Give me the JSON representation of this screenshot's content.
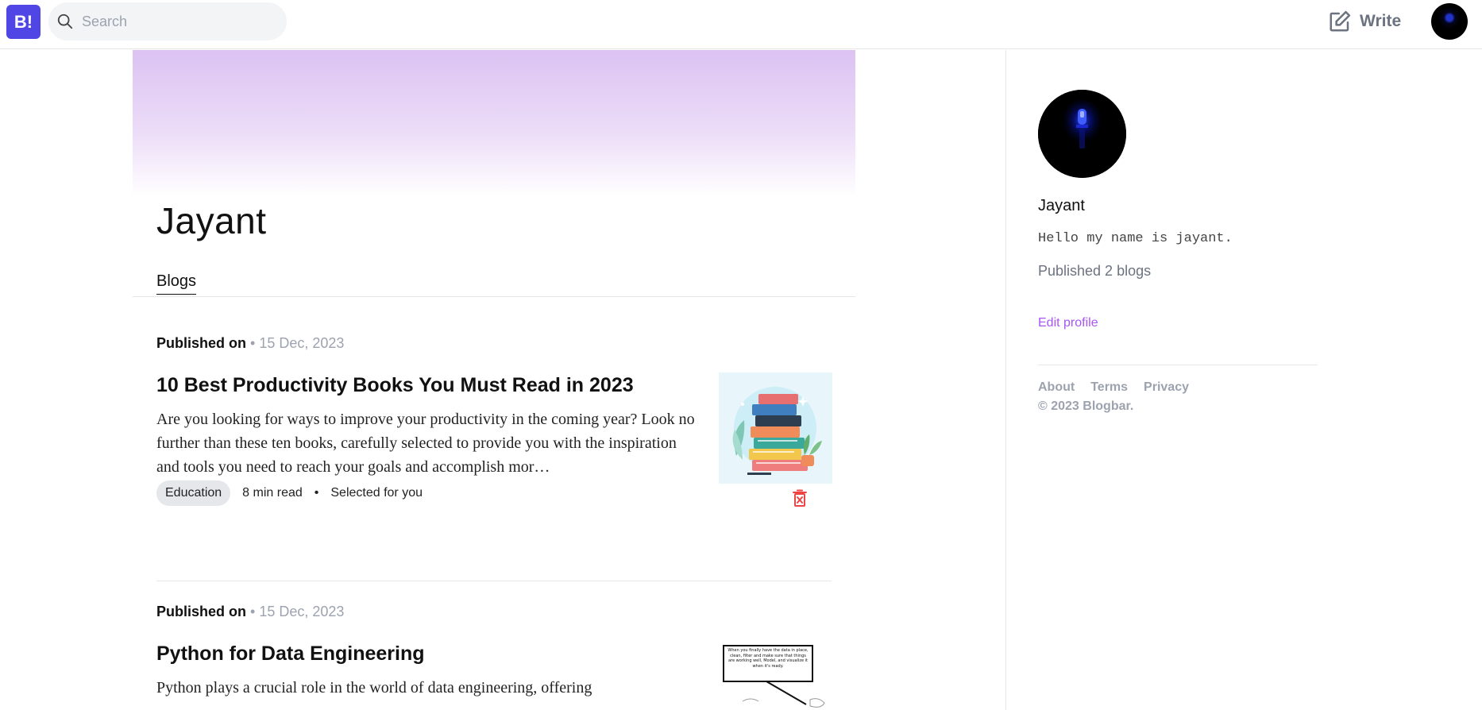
{
  "app": {
    "logo_text": "B!"
  },
  "search": {
    "placeholder": "Search",
    "value": ""
  },
  "header": {
    "write_label": "Write"
  },
  "profile": {
    "name": "Jayant",
    "tab": "Blogs"
  },
  "posts": [
    {
      "published_label": "Published on",
      "date": "15 Dec, 2023",
      "title": "10 Best Productivity Books You Must Read in 2023",
      "excerpt": "Are you looking for ways to improve your productivity in the coming year? Look no further than these ten books, carefully selected to provide you with the inspiration and tools you need to reach your goals and accomplish mor…",
      "tag": "Education",
      "read_time": "8 min read",
      "selected": "Selected for you",
      "thumbnail": "book-stack-illustration"
    },
    {
      "published_label": "Published on",
      "date": "15 Dec, 2023",
      "title": "Python for Data Engineering",
      "excerpt": "Python plays a crucial role in the world of data engineering, offering",
      "thumbnail": "speech-bubble-comic",
      "thumb_caption": "When you finally have the data in place, clean, filter and make sure that things are working well, Model, and visualize it when it's ready."
    }
  ],
  "sidebar": {
    "name": "Jayant",
    "bio": "Hello my name is jayant.",
    "published_count": "Published 2 blogs",
    "edit_label": "Edit profile",
    "links": [
      "About",
      "Terms",
      "Privacy"
    ],
    "copyright": "© 2023 Blogbar."
  },
  "colors": {
    "brand": "#4f46e5",
    "accent": "#a855f7",
    "delete": "#ef4444",
    "banner_top": "#dcc2f2"
  }
}
